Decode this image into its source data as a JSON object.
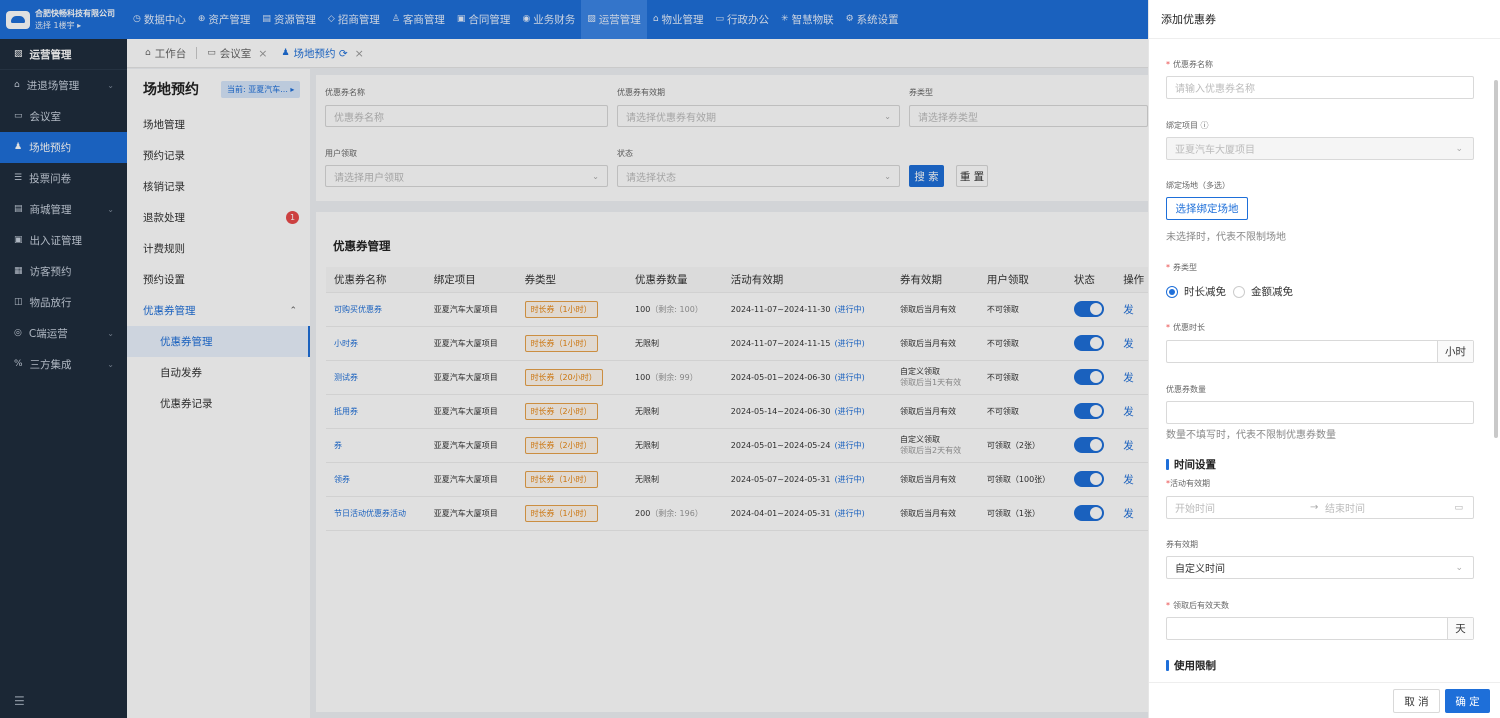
{
  "brand": {
    "company": "合肥快畅科技有限公司",
    "building": "选择 1楼宇 ▸"
  },
  "topnav": [
    {
      "icon": "dashboard-icon",
      "glyph": "◷",
      "label": "数据中心"
    },
    {
      "icon": "asset-icon",
      "glyph": "⊕",
      "label": "资产管理"
    },
    {
      "icon": "resource-icon",
      "glyph": "▤",
      "label": "资源管理"
    },
    {
      "icon": "invest-icon",
      "glyph": "◇",
      "label": "招商管理"
    },
    {
      "icon": "tenant-icon",
      "glyph": "♙",
      "label": "客商管理"
    },
    {
      "icon": "contract-icon",
      "glyph": "▣",
      "label": "合同管理"
    },
    {
      "icon": "finance-icon",
      "glyph": "◉",
      "label": "业务财务"
    },
    {
      "icon": "operation-icon",
      "glyph": "▨",
      "label": "运营管理"
    },
    {
      "icon": "property-icon",
      "glyph": "⌂",
      "label": "物业管理"
    },
    {
      "icon": "office-icon",
      "glyph": "▭",
      "label": "行政办公"
    },
    {
      "icon": "iot-icon",
      "glyph": "✳",
      "label": "智慧物联"
    },
    {
      "icon": "settings-icon",
      "glyph": "⚙",
      "label": "系统设置"
    }
  ],
  "sidebar": {
    "header": {
      "glyph": "▨",
      "label": "运营管理"
    },
    "items": [
      {
        "glyph": "⌂",
        "label": "进退场管理",
        "chev": "⌄"
      },
      {
        "glyph": "▭",
        "label": "会议室",
        "chev": ""
      },
      {
        "glyph": "♟",
        "label": "场地预约",
        "chev": ""
      },
      {
        "glyph": "☰",
        "label": "投票问卷",
        "chev": ""
      },
      {
        "glyph": "▤",
        "label": "商城管理",
        "chev": "⌄"
      },
      {
        "glyph": "▣",
        "label": "出入证管理",
        "chev": ""
      },
      {
        "glyph": "▦",
        "label": "访客预约",
        "chev": ""
      },
      {
        "glyph": "◫",
        "label": "物品放行",
        "chev": ""
      },
      {
        "glyph": "◎",
        "label": "C端运营",
        "chev": "⌄"
      },
      {
        "glyph": "%",
        "label": "三方集成",
        "chev": "⌄"
      }
    ],
    "footer_glyph": "☰"
  },
  "tabs": [
    {
      "glyph": "⌂",
      "label": "工作台",
      "close": ""
    },
    {
      "glyph": "▭",
      "label": "会议室",
      "close": "×"
    },
    {
      "glyph": "♟",
      "label": "场地预约 ⟳",
      "close": "×"
    }
  ],
  "submenu": {
    "title": "场地预约",
    "badge": "当前: 亚夏汽车... ▸",
    "items": [
      "场地管理",
      "预约记录",
      "核销记录",
      "退款处理",
      "计费规则",
      "预约设置"
    ],
    "refund_count": "1",
    "group": "优惠券管理",
    "group_chev": "⌃",
    "subitems": [
      "优惠券管理",
      "自动发券",
      "优惠券记录"
    ]
  },
  "filter": {
    "name_label": "优惠券名称",
    "name_placeholder": "优惠券名称",
    "validity_label": "优惠券有效期",
    "validity_placeholder": "请选择优惠券有效期",
    "type_label": "券类型",
    "type_placeholder": "请选择券类型",
    "claim_label": "用户领取",
    "claim_placeholder": "请选择用户领取",
    "status_label": "状态",
    "status_placeholder": "请选择状态",
    "search": "搜 索",
    "reset": "重 置",
    "arrow": "⌄"
  },
  "table": {
    "title": "优惠券管理",
    "headers": [
      "优惠券名称",
      "绑定项目",
      "券类型",
      "优惠券数量",
      "活动有效期",
      "券有效期",
      "用户领取",
      "状态",
      "操作"
    ],
    "rows": [
      {
        "name": "可购买优惠券",
        "project": "亚夏汽车大厦项目",
        "type": "时长券（1小时）",
        "qty": "100",
        "qty_note": "（剩余: 100）",
        "period": "2024-11-07~2024-11-30",
        "state": "(进行中)",
        "validity": "领取后当月有效",
        "validity2": "",
        "claim": "不可领取",
        "op": "发"
      },
      {
        "name": "小时券",
        "project": "亚夏汽车大厦项目",
        "type": "时长券（1小时）",
        "qty": "无限制",
        "qty_note": "",
        "period": "2024-11-07~2024-11-15",
        "state": "(进行中)",
        "validity": "领取后当月有效",
        "validity2": "",
        "claim": "不可领取",
        "op": "发"
      },
      {
        "name": "测试券",
        "project": "亚夏汽车大厦项目",
        "type": "时长券（20小时）",
        "qty": "100",
        "qty_note": "（剩余: 99）",
        "period": "2024-05-01~2024-06-30",
        "state": "(进行中)",
        "validity": "自定义领取",
        "validity2": "领取后当1天有效",
        "claim": "不可领取",
        "op": "发"
      },
      {
        "name": "抵用券",
        "project": "亚夏汽车大厦项目",
        "type": "时长券（2小时）",
        "qty": "无限制",
        "qty_note": "",
        "period": "2024-05-14~2024-06-30",
        "state": "(进行中)",
        "validity": "领取后当月有效",
        "validity2": "",
        "claim": "不可领取",
        "op": "发"
      },
      {
        "name": "券",
        "project": "亚夏汽车大厦项目",
        "type": "时长券（2小时）",
        "qty": "无限制",
        "qty_note": "",
        "period": "2024-05-01~2024-05-24",
        "state": "(进行中)",
        "validity": "自定义领取",
        "validity2": "领取后当2天有效",
        "claim": "可领取（2张）",
        "op": "发"
      },
      {
        "name": "领券",
        "project": "亚夏汽车大厦项目",
        "type": "时长券（1小时）",
        "qty": "无限制",
        "qty_note": "",
        "period": "2024-05-07~2024-05-31",
        "state": "(进行中)",
        "validity": "领取后当月有效",
        "validity2": "",
        "claim": "可领取（100张）",
        "op": "发"
      },
      {
        "name": "节日活动优惠券活动",
        "project": "亚夏汽车大厦项目",
        "type": "时长券（1小时）",
        "qty": "200",
        "qty_note": "（剩余: 196）",
        "period": "2024-04-01~2024-05-31",
        "state": "(进行中)",
        "validity": "领取后当月有效",
        "validity2": "",
        "claim": "可领取（1张）",
        "op": "发"
      }
    ]
  },
  "drawer": {
    "title": "添加优惠券",
    "req": "*",
    "name_label": "优惠券名称",
    "name_placeholder": "请输入优惠券名称",
    "project_label": "绑定项目 ⓘ",
    "project_value": "亚夏汽车大厦项目",
    "venue_label": "绑定场地（多选）",
    "venue_button": "选择绑定场地",
    "venue_hint": "未选择时，代表不限制场地",
    "type_label": "券类型",
    "type_options": [
      "时长减免",
      "金额减免"
    ],
    "duration_label": "优惠时长",
    "duration_suffix": "小时",
    "qty_label": "优惠券数量",
    "qty_hint": "数量不填写时，代表不限制优惠券数量",
    "time_section": "时间设置",
    "period_label": "活动有效期",
    "start_placeholder": "开始时间",
    "period_arrow": "→",
    "end_placeholder": "结束时间",
    "calendar_glyph": "▭",
    "validity_label": "券有效期",
    "validity_value": "自定义时间",
    "days_label": "领取后有效天数",
    "days_suffix": "天",
    "limit_section": "使用限制",
    "cancel": "取 消",
    "confirm": "确 定",
    "arrow": "⌄"
  }
}
